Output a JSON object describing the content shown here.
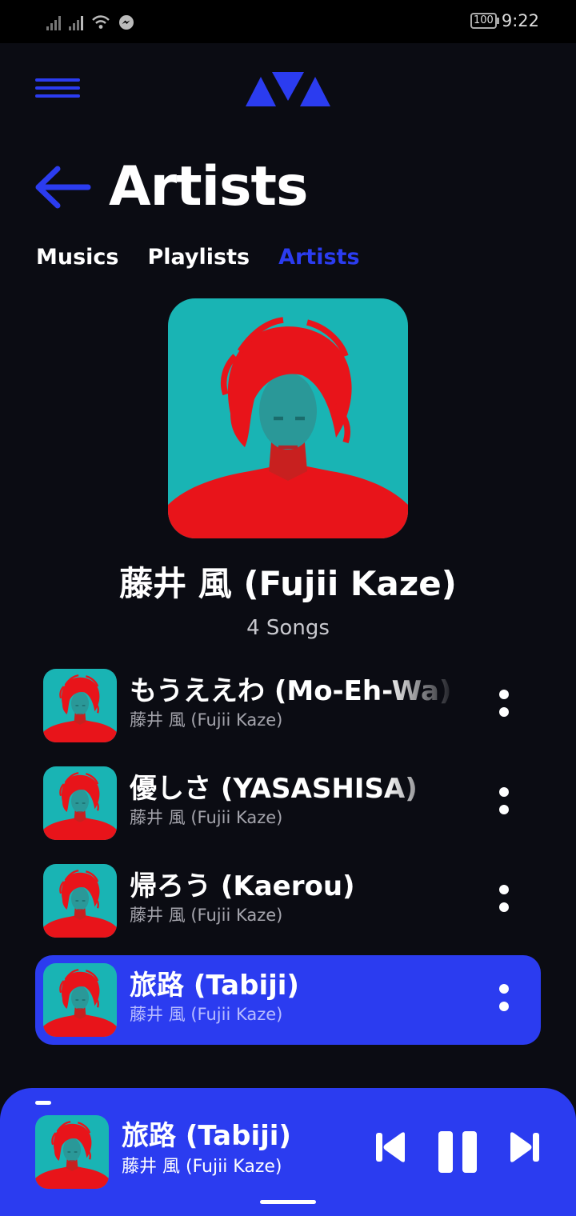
{
  "status_bar": {
    "time": "9:22",
    "battery": "100"
  },
  "header": {
    "page_title": "Artists"
  },
  "tabs": [
    {
      "label": "Musics",
      "active": false
    },
    {
      "label": "Playlists",
      "active": false
    },
    {
      "label": "Artists",
      "active": true
    }
  ],
  "artist": {
    "name": "藤井 風 (Fujii Kaze)",
    "song_count": "4 Songs"
  },
  "songs": [
    {
      "title": "もうええわ (Mo-Eh-Wa)",
      "artist": "藤井 風 (Fujii Kaze)",
      "active": false
    },
    {
      "title": "優しさ (YASASHISA)",
      "artist": "藤井 風 (Fujii Kaze)",
      "active": false
    },
    {
      "title": "帰ろう (Kaerou)",
      "artist": "藤井 風 (Fujii Kaze)",
      "active": false
    },
    {
      "title": "旅路 (Tabiji)",
      "artist": "藤井 風 (Fujii Kaze)",
      "active": true
    }
  ],
  "now_playing": {
    "title": "旅路 (Tabiji)",
    "artist": "藤井 風 (Fujii Kaze)",
    "state": "playing"
  },
  "colors": {
    "accent": "#2b3cf0",
    "background": "#0b0c13",
    "art_bg": "#19b4b4",
    "art_fg": "#e8141a"
  },
  "icons": [
    "menu-icon",
    "app-logo-icon",
    "back-arrow-icon",
    "more-vertical-icon",
    "previous-icon",
    "pause-icon",
    "next-icon"
  ]
}
